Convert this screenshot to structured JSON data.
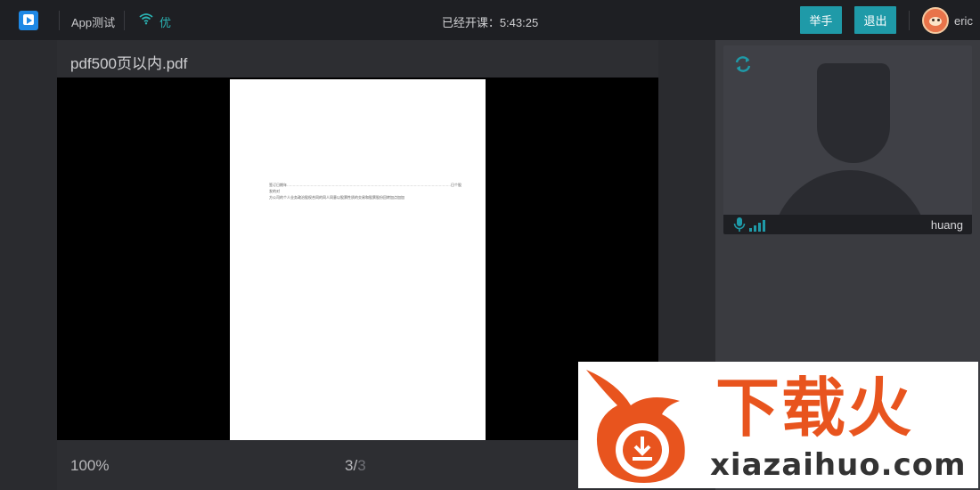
{
  "topbar": {
    "app_name": "App测试",
    "network_quality": "优",
    "class_time": "已经开课：5:43:25",
    "raise_hand_label": "举手",
    "exit_label": "退出",
    "user_name": "eric"
  },
  "document": {
    "title": "pdf500页以内.pdf",
    "page_text": "签订日期年…………………………………………………………………………………………………………………………日个股发的对\n方公司的个人业务政治股权合同的同人同意以股票性质的交易和股票股份回转加点加加",
    "zoom": "100%",
    "current_page": "3/",
    "total_pages": "3"
  },
  "video": {
    "participant_name": "huang"
  },
  "watermark": {
    "brand": "下载火",
    "url": "xiazaihuo.com"
  },
  "colors": {
    "accent": "#1f9aa8",
    "topbar_bg": "#1e1f23",
    "panel_bg": "#2d2e32",
    "watermark_orange": "#e8541e"
  }
}
